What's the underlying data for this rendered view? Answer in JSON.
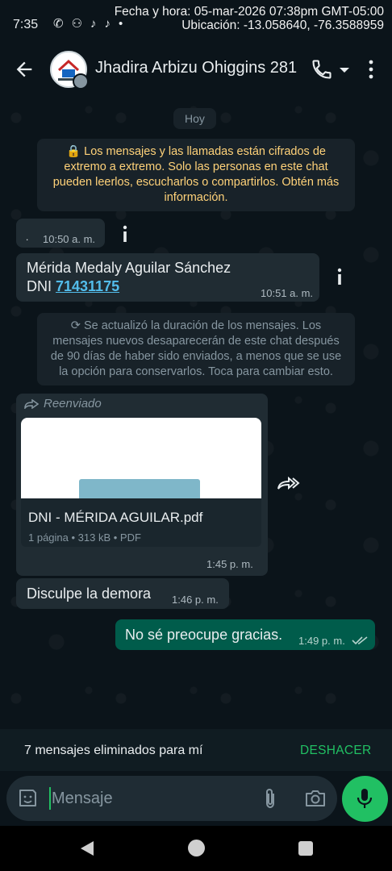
{
  "status_bar": {
    "time": "7:35",
    "icons": [
      "whatsapp-icon",
      "network-icon",
      "tiktok-icon",
      "tiktok-icon",
      "dot-icon"
    ],
    "stamp_line1": "Fecha y hora: 05-mar-2026 07:38pm GMT-05:00",
    "stamp_line2": "Ubicación: -13.058640, -76.3588959"
  },
  "header": {
    "contact_name": "Jhadira Arbizu Ohiggins 281",
    "back_icon": "arrow-left-icon",
    "call_icon": "phone-icon",
    "menu_icon": "kebab-icon"
  },
  "chat": {
    "day_label": "Hoy",
    "encryption_notice": "🔒 Los mensajes y las llamadas están cifrados de extremo a extremo. Solo las personas en este chat pueden leerlos, escucharlos o compartirlos. Obtén más información.",
    "messages": [
      {
        "text": ".",
        "time": "10:50 a. m."
      },
      {
        "line1": "Mérida Medaly Aguilar Sánchez",
        "line2_prefix": "DNI ",
        "dni": "71431175",
        "time": "10:51 a. m."
      },
      {
        "forwarded_label": "Reenviado",
        "file_name": "DNI - MÉRIDA AGUILAR.pdf",
        "file_meta": "1 página • 313 kB • PDF",
        "time": "1:45 p. m."
      },
      {
        "text": "Disculpe la demora",
        "time": "1:46 p. m."
      },
      {
        "text": "No sé preocupe gracias.",
        "time": "1:49 p. m."
      }
    ],
    "timer_notice": "⟳ Se actualizó la duración de los mensajes. Los mensajes nuevos desaparecerán de este chat después de 90 días de haber sido enviados, a menos que se use la opción para conservarlos. Toca para cambiar esto."
  },
  "deleted_bar": {
    "text": "7 mensajes eliminados para mí",
    "undo_label": "DESHACER"
  },
  "composer": {
    "placeholder": "Mensaje"
  },
  "colors": {
    "background": "#0b141a",
    "incoming_bubble": "#202c33",
    "outgoing_bubble": "#005c4b",
    "accent_green": "#21c063",
    "link_blue": "#53bdeb",
    "notice_yellow": "#ffd279"
  }
}
